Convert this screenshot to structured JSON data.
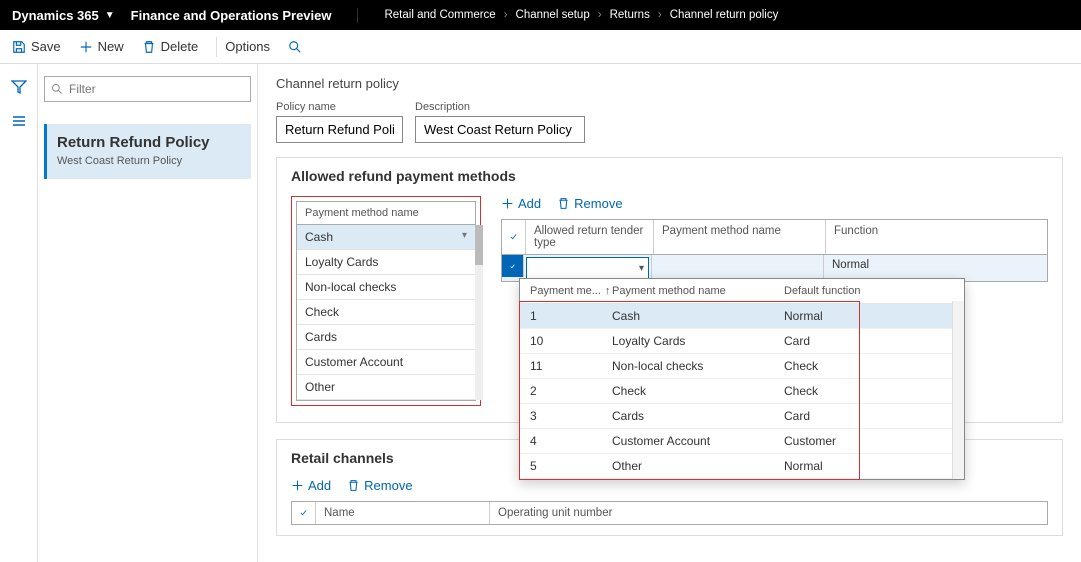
{
  "topbar": {
    "app": "Dynamics 365",
    "title": "Finance and Operations Preview",
    "breadcrumbs": [
      "Retail and Commerce",
      "Channel setup",
      "Returns",
      "Channel return policy"
    ]
  },
  "commands": {
    "save": "Save",
    "new": "New",
    "delete": "Delete",
    "options": "Options"
  },
  "filter_placeholder": "Filter",
  "list_item": {
    "title": "Return Refund Policy",
    "subtitle": "West Coast Return Policy"
  },
  "page_title": "Channel return policy",
  "field_policy_name": {
    "label": "Policy name",
    "value": "Return Refund Policy"
  },
  "field_description": {
    "label": "Description",
    "value": "West Coast Return Policy"
  },
  "section_allowed": "Allowed refund payment methods",
  "pm_header": "Payment method name",
  "payment_methods": [
    "Cash",
    "Loyalty Cards",
    "Non-local checks",
    "Check",
    "Cards",
    "Customer Account",
    "Other"
  ],
  "add_label": "Add",
  "remove_label": "Remove",
  "return_table": {
    "col_tender": "Allowed return tender type",
    "col_pm": "Payment method name",
    "col_fn": "Function",
    "row_fn": "Normal"
  },
  "lookup": {
    "col_id": "Payment me...",
    "col_name": "Payment method name",
    "col_fn": "Default function",
    "rows": [
      {
        "id": "1",
        "name": "Cash",
        "fn": "Normal"
      },
      {
        "id": "10",
        "name": "Loyalty Cards",
        "fn": "Card"
      },
      {
        "id": "11",
        "name": "Non-local checks",
        "fn": "Check"
      },
      {
        "id": "2",
        "name": "Check",
        "fn": "Check"
      },
      {
        "id": "3",
        "name": "Cards",
        "fn": "Card"
      },
      {
        "id": "4",
        "name": "Customer Account",
        "fn": "Customer"
      },
      {
        "id": "5",
        "name": "Other",
        "fn": "Normal"
      }
    ]
  },
  "section_retail": "Retail channels",
  "retail_table": {
    "col_name": "Name",
    "col_unit": "Operating unit number"
  }
}
